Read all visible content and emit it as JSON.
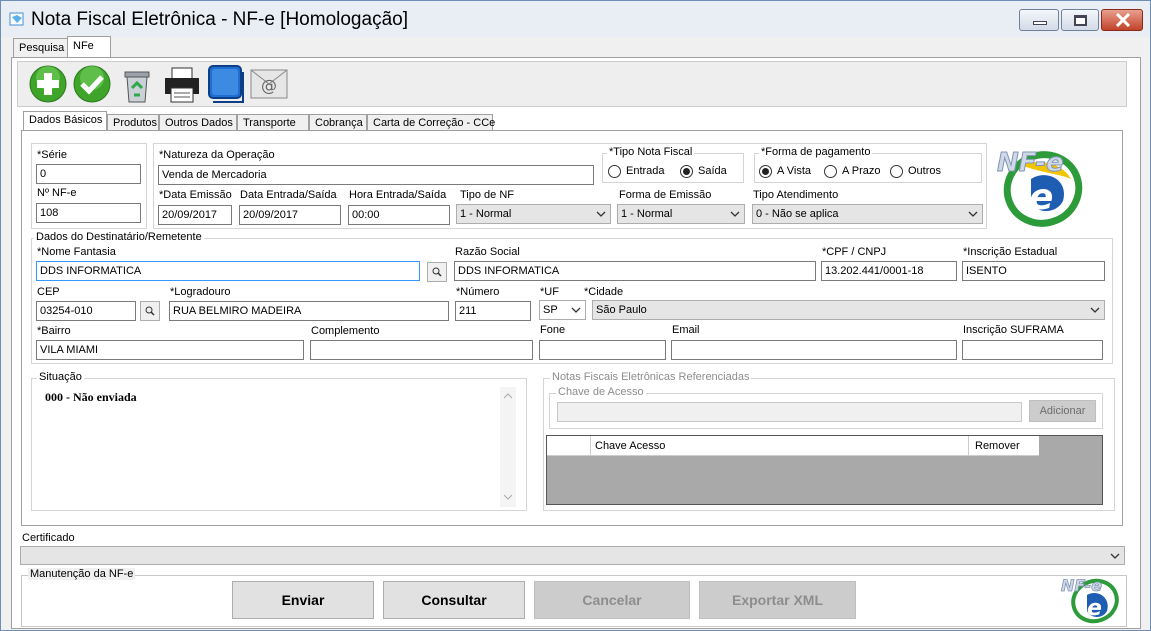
{
  "window": {
    "title": "Nota Fiscal Eletrônica - NF-e [Homologação]"
  },
  "outer_tabs": [
    "Pesquisa",
    "NFe"
  ],
  "toolbar": {
    "icons": [
      "add-icon",
      "confirm-icon",
      "recycle-bin-icon",
      "printer-icon",
      "window-icon",
      "email-icon"
    ]
  },
  "inner_tabs": [
    "Dados Básicos",
    "Produtos",
    "Outros Dados",
    "Transporte",
    "Cobrança",
    "Carta de Correção - CCe"
  ],
  "serie": {
    "label": "*Série",
    "value": "0"
  },
  "nf_numero": {
    "label": "Nº NF-e",
    "value": "108"
  },
  "natureza": {
    "label": "*Natureza da Operação",
    "value": "Venda de Mercadoria"
  },
  "tipo_nota": {
    "label": "*Tipo Nota Fiscal",
    "options": [
      "Entrada",
      "Saída"
    ],
    "selected": "Saída"
  },
  "forma_pagamento": {
    "label": "*Forma de pagamento",
    "options": [
      "A Vista",
      "A Prazo",
      "Outros"
    ],
    "selected": "A Vista"
  },
  "data_emissao": {
    "label": "*Data Emissão",
    "value": "20/09/2017"
  },
  "data_entrada": {
    "label": "Data Entrada/Saída",
    "value": "20/09/2017"
  },
  "hora_entrada": {
    "label": "Hora Entrada/Saída",
    "value": "00:00"
  },
  "tipo_nf": {
    "label": "Tipo de NF",
    "value": "1 - Normal"
  },
  "forma_emissao": {
    "label": "Forma de Emissão",
    "value": "1 - Normal"
  },
  "tipo_atendimento": {
    "label": "Tipo Atendimento",
    "value": "0 - Não se aplica"
  },
  "destinatario": {
    "group_label": "Dados do Destinatário/Remetente",
    "nome_fantasia": {
      "label": "*Nome Fantasia",
      "value": "DDS INFORMATICA"
    },
    "razao_social": {
      "label": "Razão Social",
      "value": "DDS INFORMATICA"
    },
    "cpf_cnpj": {
      "label": "*CPF / CNPJ",
      "value": "13.202.441/0001-18"
    },
    "inscricao_estadual": {
      "label": "*Inscrição Estadual",
      "value": "ISENTO"
    },
    "cep": {
      "label": "CEP",
      "value": "03254-010"
    },
    "logradouro": {
      "label": "*Logradouro",
      "value": "RUA BELMIRO MADEIRA"
    },
    "numero": {
      "label": "*Número",
      "value": "211"
    },
    "uf": {
      "label": "*UF",
      "value": "SP"
    },
    "cidade": {
      "label": "*Cidade",
      "value": "São Paulo"
    },
    "bairro": {
      "label": "*Bairro",
      "value": "VILA MIAMI"
    },
    "complemento": {
      "label": "Complemento",
      "value": ""
    },
    "fone": {
      "label": "Fone",
      "value": ""
    },
    "email": {
      "label": "Email",
      "value": ""
    },
    "suframa": {
      "label": "Inscrição SUFRAMA",
      "value": ""
    }
  },
  "situacao": {
    "label": "Situação",
    "value": "000 - Não enviada"
  },
  "referenciadas": {
    "group_label": "Notas Fiscais Eletrônicas Referenciadas",
    "chave_label": "Chave de Acesso",
    "chave_value": "",
    "add_button": "Adicionar",
    "columns": [
      "Chave Acesso",
      "Remover"
    ]
  },
  "certificado": {
    "label": "Certificado",
    "value": ""
  },
  "manutencao": {
    "group_label": "Manutenção da NF-e",
    "buttons": [
      "Enviar",
      "Consultar",
      "Cancelar",
      "Exportar XML"
    ]
  },
  "logo": {
    "text": "NF-e"
  },
  "colors": {
    "title_bar": "#e9eef5",
    "accent_green": "#3a9d2a",
    "accent_blue": "#1f6fd0"
  }
}
